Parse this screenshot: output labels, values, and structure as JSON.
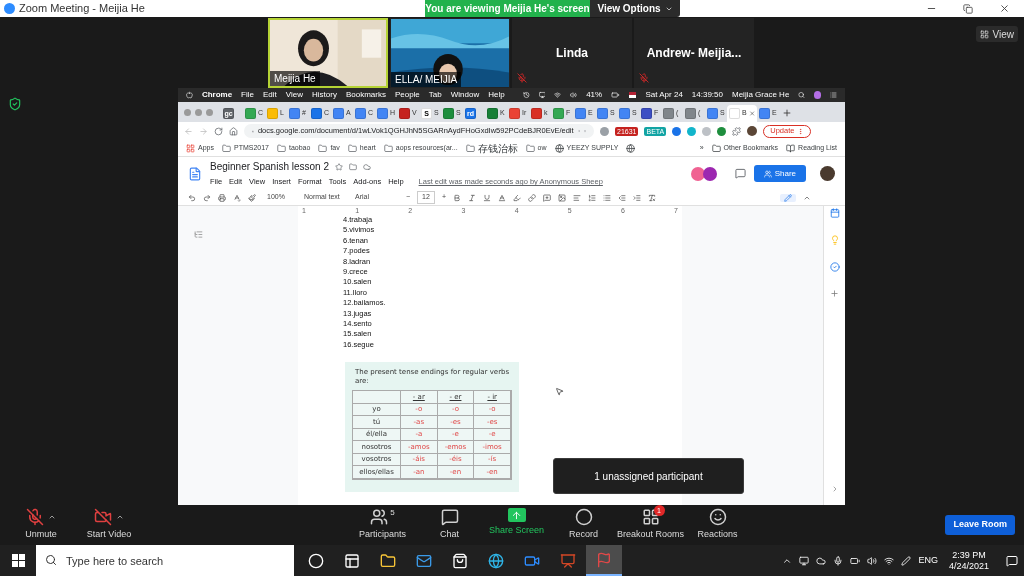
{
  "window": {
    "title": "Zoom Meeting - Meijia He"
  },
  "banner": {
    "text": "You are viewing Meijia He's screen",
    "view_options": "View Options"
  },
  "view_button": "View",
  "participants_strip": [
    {
      "name": "Meijia He",
      "kind": "video",
      "active": true,
      "muted": false
    },
    {
      "name": "ELLA/ MEIJIA",
      "kind": "video",
      "active": false,
      "muted": false
    },
    {
      "name": "Linda",
      "kind": "name",
      "active": false,
      "muted": true
    },
    {
      "name": "Andrew-  Meijia...",
      "kind": "name",
      "active": false,
      "muted": true
    }
  ],
  "shared_screen": {
    "mac_menubar": {
      "app": "Chrome",
      "menus": [
        "File",
        "Edit",
        "View",
        "History",
        "Bookmarks",
        "People",
        "Tab",
        "Window",
        "Help"
      ],
      "battery": "41%",
      "date": "Sat Apr 24",
      "time": "14:39:50",
      "user": "Meijia Grace He"
    },
    "tabs": [
      {
        "favicon_text": "gc",
        "color": "#5f6368",
        "selected": false
      },
      {
        "label": "C",
        "color": "#34a853",
        "selected": false
      },
      {
        "label": "L",
        "color": "#fbbc04",
        "selected": false
      },
      {
        "label": "#",
        "color": "#4285f4",
        "selected": false
      },
      {
        "label": "C",
        "color": "#1a73e8",
        "selected": false
      },
      {
        "label": "A",
        "color": "#4285f4",
        "selected": false
      },
      {
        "label": "C",
        "color": "#4285f4",
        "selected": false
      },
      {
        "label": "H",
        "color": "#4285f4",
        "selected": false
      },
      {
        "label": "V",
        "color": "#c5221f",
        "selected": false
      },
      {
        "favicon_text": "S",
        "label": "S",
        "color": "#ffffff",
        "selected": false
      },
      {
        "label": "S",
        "color": "#1e8e3e",
        "selected": false
      },
      {
        "favicon_text": "rd",
        "color": "#1a73e8",
        "selected": false
      },
      {
        "label": "K",
        "color": "#188038",
        "selected": false
      },
      {
        "label": "Ir",
        "color": "#ea4335",
        "selected": false
      },
      {
        "label": "k",
        "color": "#d93025",
        "selected": false
      },
      {
        "label": "F",
        "color": "#34a853",
        "selected": false
      },
      {
        "label": "E",
        "color": "#4285f4",
        "selected": false
      },
      {
        "label": "S",
        "color": "#4285f4",
        "selected": false
      },
      {
        "label": "S",
        "color": "#4285f4",
        "selected": false
      },
      {
        "label": "F",
        "color": "#3c4fc4",
        "selected": false
      },
      {
        "label": "(",
        "color": "#80868b",
        "selected": false
      },
      {
        "label": "(",
        "color": "#80868b",
        "selected": false
      },
      {
        "label": "S",
        "color": "#4285f4",
        "selected": false
      },
      {
        "label": "B",
        "color": "#ffffff",
        "selected": true
      },
      {
        "label": "E",
        "color": "#4285f4",
        "selected": false
      }
    ],
    "url": "docs.google.com/document/d/1wLVok1QGHJhN5SGARnAydFHoGxdIw592PCdeBJR0EvE/edit",
    "extensions": [
      {
        "color": "#9aa0a6"
      },
      {
        "color": "#c5221f",
        "badge": "21631"
      },
      {
        "color": "#12a4a4",
        "badge": "BETA"
      },
      {
        "color": "#1a73e8"
      },
      {
        "color": "#12b5cb"
      },
      {
        "color": "#bdc1c6"
      },
      {
        "color": "#1e8e3e"
      }
    ],
    "update": "Update",
    "bookmarks": [
      {
        "kind": "apps",
        "label": "Apps"
      },
      {
        "kind": "folder",
        "label": "PTMS2017"
      },
      {
        "kind": "folder",
        "label": "taobao"
      },
      {
        "kind": "folder",
        "label": "fav"
      },
      {
        "kind": "folder",
        "label": "heart"
      },
      {
        "kind": "folder",
        "label": "aops resources(ar..."
      },
      {
        "kind": "folder",
        "label": "存钱治标"
      },
      {
        "kind": "folder",
        "label": "ow"
      },
      {
        "kind": "globe",
        "label": "YEEZY SUPPLY"
      },
      {
        "kind": "globe"
      }
    ],
    "bookmarks_more": "»",
    "other_bookmarks": "Other Bookmarks",
    "reading_list": "Reading List",
    "doc": {
      "title": "Beginner Spanish lesson 2",
      "menus": [
        "File",
        "Edit",
        "View",
        "Insert",
        "Format",
        "Tools",
        "Add-ons",
        "Help"
      ],
      "last_edit": "Last edit was made seconds ago by Anonymous Sheep",
      "share": "Share",
      "toolbar": {
        "zoom": "100%",
        "style": "Normal text",
        "font": "Arial",
        "size": "12",
        "minus": "−",
        "plus": "+"
      },
      "ruler": [
        "1",
        "1",
        "2",
        "3",
        "4",
        "5",
        "6",
        "7"
      ],
      "lines": [
        "4.trabaja",
        "5.vivimos",
        "6.tenan",
        "7.podes",
        "8.ladran",
        "9.crece",
        "10.salen",
        "11.lloro",
        "12.bailamos.",
        "13.jugas",
        "14.sento",
        "15.salen",
        "16.segue"
      ],
      "table_image": {
        "caption": "The present tense endings for regular verbs are:",
        "columns": [
          "- ar",
          "- er",
          "- ir"
        ],
        "rows": [
          {
            "pronoun": "yo",
            "endings": [
              "-o",
              "-o",
              "-o"
            ]
          },
          {
            "pronoun": "tú",
            "endings": [
              "-as",
              "-es",
              "-es"
            ]
          },
          {
            "pronoun": "él/ella",
            "endings": [
              "-a",
              "-e",
              "-e"
            ]
          },
          {
            "pronoun": "nosotros",
            "endings": [
              "-amos",
              "-emos",
              "-imos"
            ]
          },
          {
            "pronoun": "vosotros",
            "endings": [
              "-áis",
              "-éis",
              "-ís"
            ]
          },
          {
            "pronoun": "ellos/ellas",
            "endings": [
              "-an",
              "-en",
              "-en"
            ]
          }
        ]
      }
    }
  },
  "tooltip": "1 unassigned participant",
  "controls_left": [
    {
      "kind": "mic",
      "label": "Unmute",
      "off": true
    },
    {
      "kind": "video",
      "label": "Start Video",
      "off": true
    }
  ],
  "controls_center": [
    {
      "kind": "participants",
      "label": "Participants",
      "count": "5"
    },
    {
      "kind": "chat",
      "label": "Chat"
    },
    {
      "kind": "share",
      "label": "Share Screen"
    },
    {
      "kind": "record",
      "label": "Record"
    },
    {
      "kind": "breakout",
      "label": "Breakout Rooms",
      "count": "1"
    },
    {
      "kind": "reactions",
      "label": "Reactions"
    }
  ],
  "leave": "Leave Room",
  "taskbar": {
    "search_placeholder": "Type here to search",
    "apps": [
      {
        "kind": "cortana",
        "active": false
      },
      {
        "kind": "taskview",
        "active": false
      },
      {
        "kind": "explorer",
        "active": false
      },
      {
        "kind": "mail",
        "active": false
      },
      {
        "kind": "store",
        "active": false
      },
      {
        "kind": "edge",
        "active": false
      },
      {
        "kind": "zoom",
        "active": false
      },
      {
        "kind": "powerpoint",
        "active": false
      },
      {
        "kind": "app",
        "active": true
      }
    ],
    "language": "ENG",
    "time": "2:39 PM",
    "date": "4/24/2021"
  }
}
